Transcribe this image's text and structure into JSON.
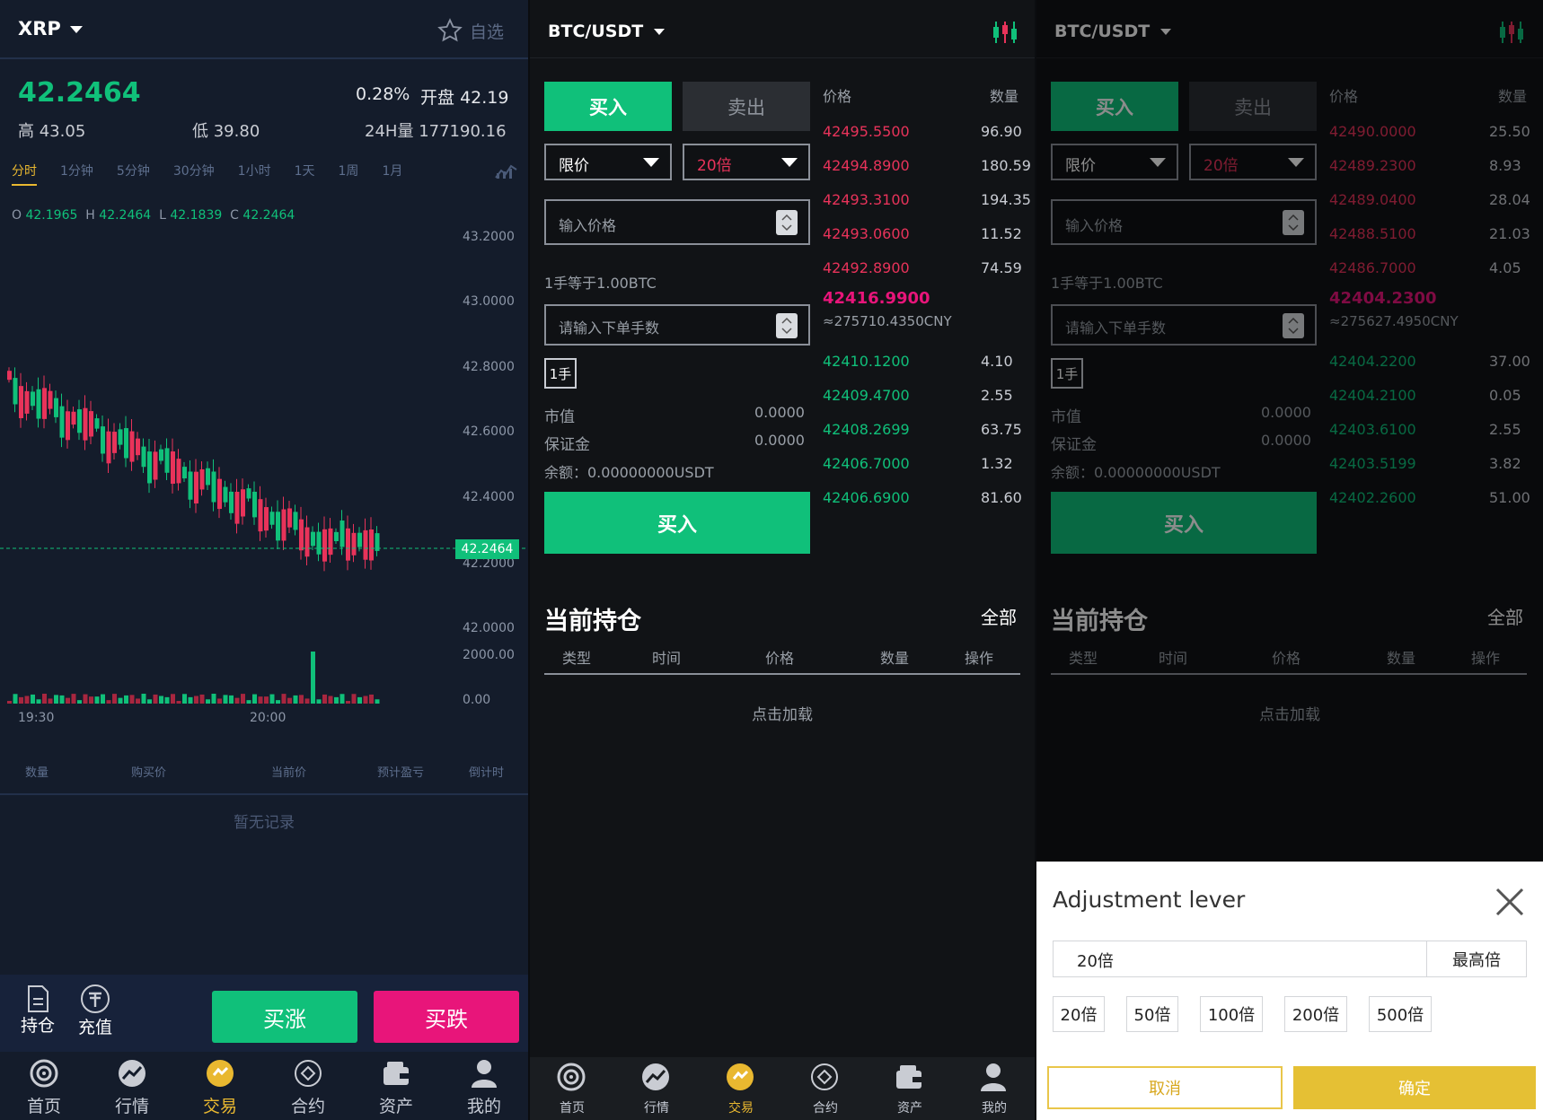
{
  "p1": {
    "symbol": "XRP",
    "watch": "自选",
    "price": "42.2464",
    "change": "0.28%",
    "open_label": "开盘",
    "open": "42.19",
    "high_label": "高",
    "high": "43.05",
    "low_label": "低",
    "low": "39.80",
    "vol_label": "24H量",
    "vol": "177190.16",
    "timeframes": [
      "分时",
      "1分钟",
      "5分钟",
      "30分钟",
      "1小时",
      "1天",
      "1周",
      "1月"
    ],
    "ohlc": {
      "o": "O",
      "o_val": "42.1965",
      "h": "H",
      "h_val": "42.2464",
      "l": "L",
      "l_val": "42.1839",
      "c": "C",
      "c_val": "42.2464"
    },
    "price_ticks": [
      "43.2000",
      "43.0000",
      "42.8000",
      "42.6000",
      "42.4000",
      "42.2000",
      "42.0000"
    ],
    "last_tag": "42.2464",
    "vol_ticks": [
      "2000.00",
      "0.00"
    ],
    "times": [
      "19:30",
      "20:00"
    ],
    "cols": [
      "数量",
      "购买价",
      "当前价",
      "预计盈亏",
      "倒计时"
    ],
    "empty": "暂无记录",
    "hold": "持仓",
    "deposit": "充值",
    "buy_up": "买涨",
    "buy_down": "买跌",
    "tabs": [
      "首页",
      "行情",
      "交易",
      "合约",
      "资产",
      "我的"
    ]
  },
  "p2": {
    "pair": "BTC/USDT",
    "buy": "买入",
    "sell": "卖出",
    "order_type": "限价",
    "lever": "20倍",
    "price_ph": "输入价格",
    "lot_info": "1手等于1.00BTC",
    "qty_ph": "请输入下单手数",
    "lot": "1手",
    "mv_label": "市值",
    "mv": "0.0000",
    "margin_label": "保证金",
    "margin": "0.0000",
    "balance": "余额：0.00000000USDT",
    "buy_btn": "买入",
    "ob_price": "价格",
    "ob_qty": "数量",
    "asks": [
      {
        "p": "42495.5500",
        "q": "96.90"
      },
      {
        "p": "42494.8900",
        "q": "180.59"
      },
      {
        "p": "42493.3100",
        "q": "194.35"
      },
      {
        "p": "42493.0600",
        "q": "11.52"
      },
      {
        "p": "42492.8900",
        "q": "74.59"
      }
    ],
    "last": "42416.9900",
    "cny": "≈275710.4350CNY",
    "bids": [
      {
        "p": "42410.1200",
        "q": "4.10"
      },
      {
        "p": "42409.4700",
        "q": "2.55"
      },
      {
        "p": "42408.2699",
        "q": "63.75"
      },
      {
        "p": "42406.7000",
        "q": "1.32"
      },
      {
        "p": "42406.6900",
        "q": "81.60"
      }
    ],
    "pos_title": "当前持仓",
    "all": "全部",
    "pos_cols": [
      "类型",
      "时间",
      "价格",
      "数量",
      "操作"
    ],
    "load": "点击加载",
    "tabs": [
      "首页",
      "行情",
      "交易",
      "合约",
      "资产",
      "我的"
    ]
  },
  "p3": {
    "pair": "BTC/USDT",
    "buy": "买入",
    "sell": "卖出",
    "order_type": "限价",
    "lever": "20倍",
    "price_ph": "输入价格",
    "lot_info": "1手等于1.00BTC",
    "qty_ph": "请输入下单手数",
    "lot": "1手",
    "mv_label": "市值",
    "mv": "0.0000",
    "margin_label": "保证金",
    "margin": "0.0000",
    "balance": "余额：0.00000000USDT",
    "buy_btn": "买入",
    "ob_price": "价格",
    "ob_qty": "数量",
    "asks": [
      {
        "p": "42490.0000",
        "q": "25.50"
      },
      {
        "p": "42489.2300",
        "q": "8.93"
      },
      {
        "p": "42489.0400",
        "q": "28.04"
      },
      {
        "p": "42488.5100",
        "q": "21.03"
      },
      {
        "p": "42486.7000",
        "q": "4.05"
      }
    ],
    "last": "42404.2300",
    "cny": "≈275627.4950CNY",
    "bids": [
      {
        "p": "42404.2200",
        "q": "37.00"
      },
      {
        "p": "42404.2100",
        "q": "0.05"
      },
      {
        "p": "42403.6100",
        "q": "2.55"
      },
      {
        "p": "42403.5199",
        "q": "3.82"
      },
      {
        "p": "42402.2600",
        "q": "51.00"
      }
    ],
    "pos_title": "当前持仓",
    "all": "全部",
    "pos_cols": [
      "类型",
      "时间",
      "价格",
      "数量",
      "操作"
    ],
    "load": "点击加载",
    "modal": {
      "title": "Adjustment lever",
      "value": "20倍",
      "max": "最高倍",
      "options": [
        "20倍",
        "50倍",
        "100倍",
        "200倍",
        "500倍"
      ],
      "cancel": "取消",
      "confirm": "确定"
    }
  },
  "colors": {
    "green": "#10c07a",
    "red": "#e8335a",
    "gold": "#e9b830",
    "pink": "#e8157a"
  },
  "icons": [
    "chevron-down-icon",
    "star-icon",
    "indicator-icon",
    "spinner-icon",
    "candle-icon",
    "document-icon",
    "tether-icon",
    "home-icon",
    "market-icon",
    "trade-icon",
    "contract-icon",
    "wallet-icon",
    "user-icon",
    "close-icon"
  ]
}
